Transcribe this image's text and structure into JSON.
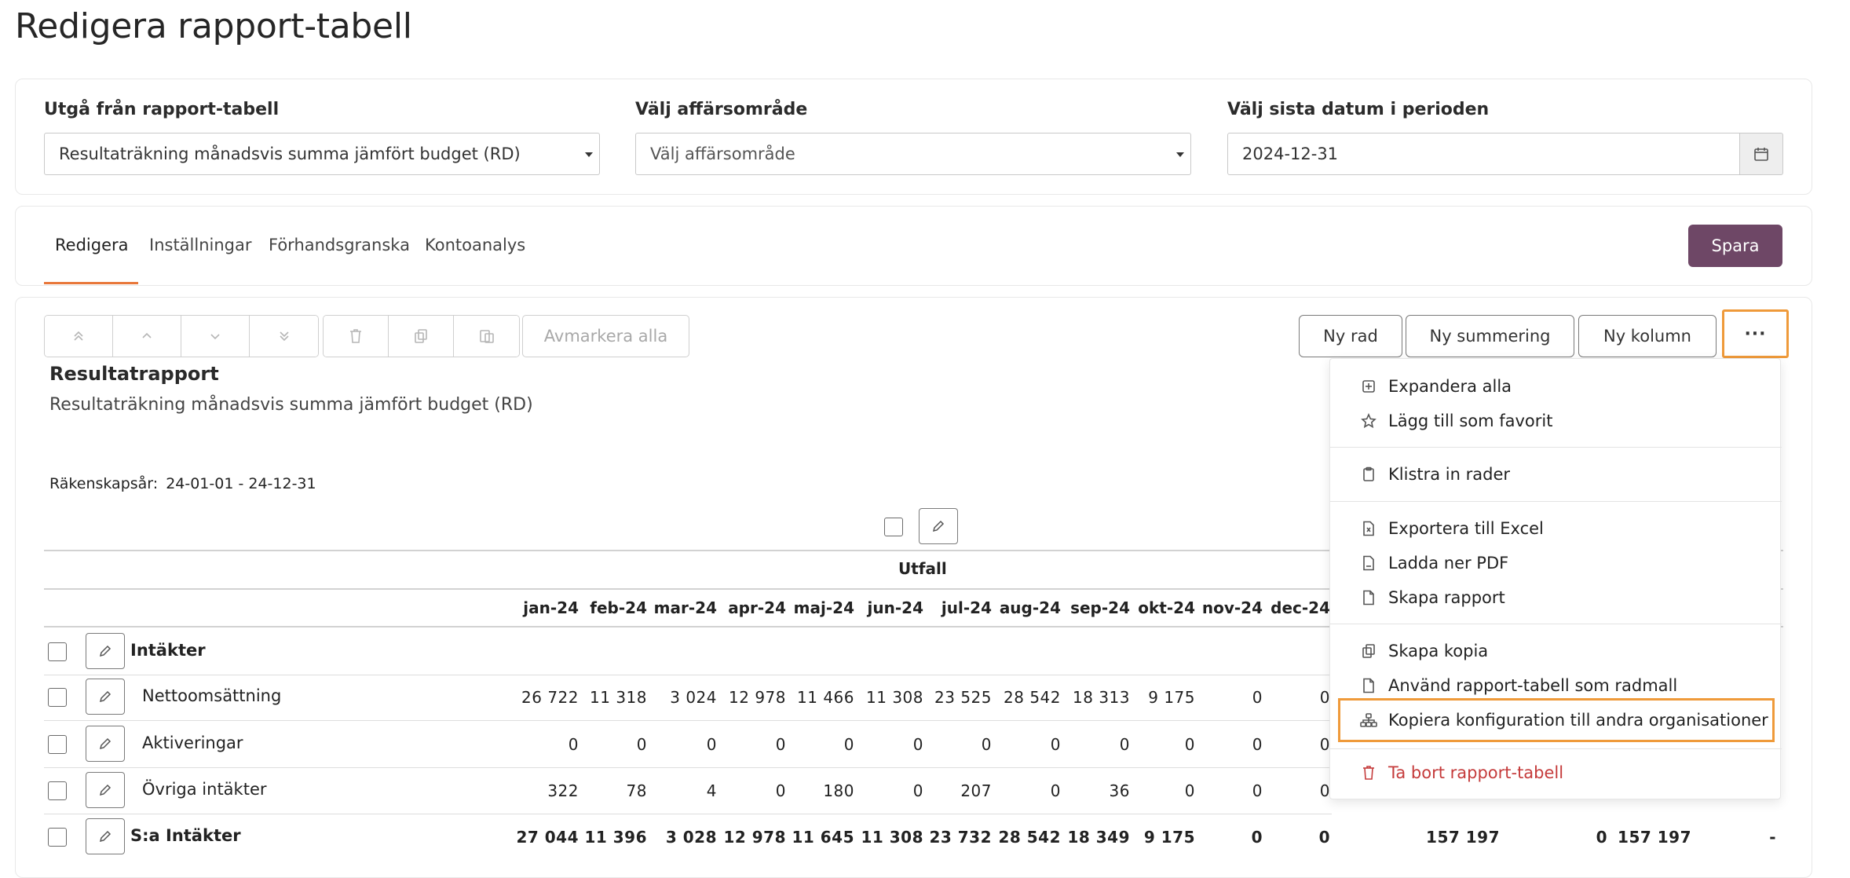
{
  "page_title": "Redigera rapport-tabell",
  "filters": {
    "report_table_label": "Utgå från rapport-tabell",
    "report_table_value": "Resultaträkning månadsvis summa jämfört budget (RD)",
    "business_area_label": "Välj affärsområde",
    "business_area_placeholder": "Välj affärsområde",
    "date_label": "Välj sista datum i perioden",
    "date_value": "2024-12-31"
  },
  "tabs": [
    {
      "label": "Redigera",
      "active": true
    },
    {
      "label": "Inställningar",
      "active": false
    },
    {
      "label": "Förhandsgranska",
      "active": false
    },
    {
      "label": "Kontoanalys",
      "active": false
    }
  ],
  "save_label": "Spara",
  "toolbar": {
    "move_icons": [
      "double-chevron-up-icon",
      "chevron-up-icon",
      "chevron-down-icon",
      "double-chevron-down-icon"
    ],
    "edit_icons": [
      "trash-icon",
      "copy-icon",
      "paste-icon"
    ],
    "deselect_all": "Avmarkera alla",
    "new_row": "Ny rad",
    "new_sum": "Ny summering",
    "new_column": "Ny kolumn",
    "more": "···"
  },
  "report": {
    "title": "Resultatrapport",
    "subtitle": "Resultaträkning månadsvis summa jämfört budget (RD)",
    "fiscal_label": "Räkenskapsår:",
    "fiscal_value": "24-01-01 - 24-12-31",
    "group_header": "Utfall",
    "months": [
      "jan-24",
      "feb-24",
      "mar-24",
      "apr-24",
      "maj-24",
      "jun-24",
      "jul-24",
      "aug-24",
      "sep-24",
      "okt-24",
      "nov-24",
      "dec-24"
    ],
    "rows": [
      {
        "label": "Intäkter",
        "bold": true,
        "values": []
      },
      {
        "label": "Nettoomsättning",
        "bold": false,
        "values": [
          "26 722",
          "11 318",
          "3 024",
          "12 978",
          "11 466",
          "11 308",
          "23 525",
          "28 542",
          "18 313",
          "9 175",
          "0",
          "0"
        ]
      },
      {
        "label": "Aktiveringar",
        "bold": false,
        "values": [
          "0",
          "0",
          "0",
          "0",
          "0",
          "0",
          "0",
          "0",
          "0",
          "0",
          "0",
          "0"
        ]
      },
      {
        "label": "Övriga intäkter",
        "bold": false,
        "values": [
          "322",
          "78",
          "4",
          "0",
          "180",
          "0",
          "207",
          "0",
          "36",
          "0",
          "0",
          "0"
        ]
      },
      {
        "label": "S:a Intäkter",
        "bold": true,
        "values": [
          "27 044",
          "11 396",
          "3 028",
          "12 978",
          "11 645",
          "11 308",
          "23 732",
          "28 542",
          "18 349",
          "9 175",
          "0",
          "0"
        ],
        "extra": [
          "157 197",
          "0",
          "157 197",
          "-"
        ]
      }
    ]
  },
  "menu": {
    "expand_all": "Expandera alla",
    "add_favorite": "Lägg till som favorit",
    "paste_rows": "Klistra in rader",
    "export_excel": "Exportera till Excel",
    "download_pdf": "Ladda ner PDF",
    "create_report": "Skapa rapport",
    "create_copy": "Skapa kopia",
    "use_as_row_template": "Använd rapport-tabell som radmall",
    "copy_config": "Kopiera konfiguration till andra organisationer",
    "delete_table": "Ta bort rapport-tabell"
  },
  "colors": {
    "accent": "#e8773a",
    "primary_button": "#6e4766",
    "highlight_outline": "#ef9a3a",
    "danger": "#c53b3b"
  }
}
